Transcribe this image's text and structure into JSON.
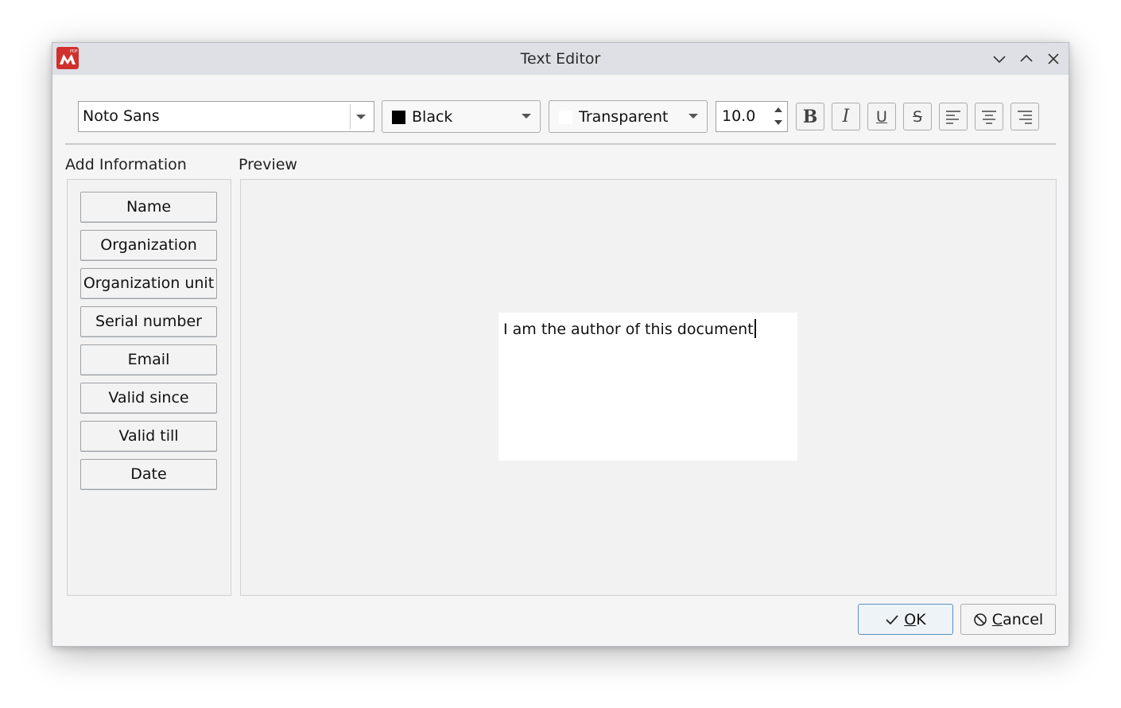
{
  "window": {
    "title": "Text Editor",
    "app_icon": "pdf-app-icon",
    "controls": [
      "minimize-icon",
      "maximize-icon",
      "close-icon"
    ]
  },
  "toolbar": {
    "font_family": "Noto Sans",
    "text_color": {
      "label": "Black",
      "swatch": "#000000"
    },
    "background_color": {
      "label": "Transparent",
      "swatch": "#ffffff"
    },
    "font_size": "10.0",
    "buttons": {
      "bold": "B",
      "italic": "I",
      "underline": "U",
      "strikethrough": "S",
      "align_left": "align-left-icon",
      "align_center": "align-center-icon",
      "align_right": "align-right-icon"
    }
  },
  "add_information": {
    "label": "Add Information",
    "buttons": [
      "Name",
      "Organization",
      "Organization unit",
      "Serial number",
      "Email",
      "Valid since",
      "Valid till",
      "Date"
    ]
  },
  "preview": {
    "label": "Preview",
    "text": "I am the author of this document"
  },
  "dialog_buttons": {
    "ok": {
      "mnemonic": "O",
      "rest": "K",
      "icon": "check-icon"
    },
    "cancel": {
      "mnemonic": "C",
      "rest": "ancel",
      "icon": "cancel-circle-icon"
    }
  },
  "colors": {
    "titlebar": "#dee0e6",
    "window_bg": "#f5f5f5",
    "app_icon_red": "#d0312d",
    "ok_border": "#5e8fc2"
  }
}
